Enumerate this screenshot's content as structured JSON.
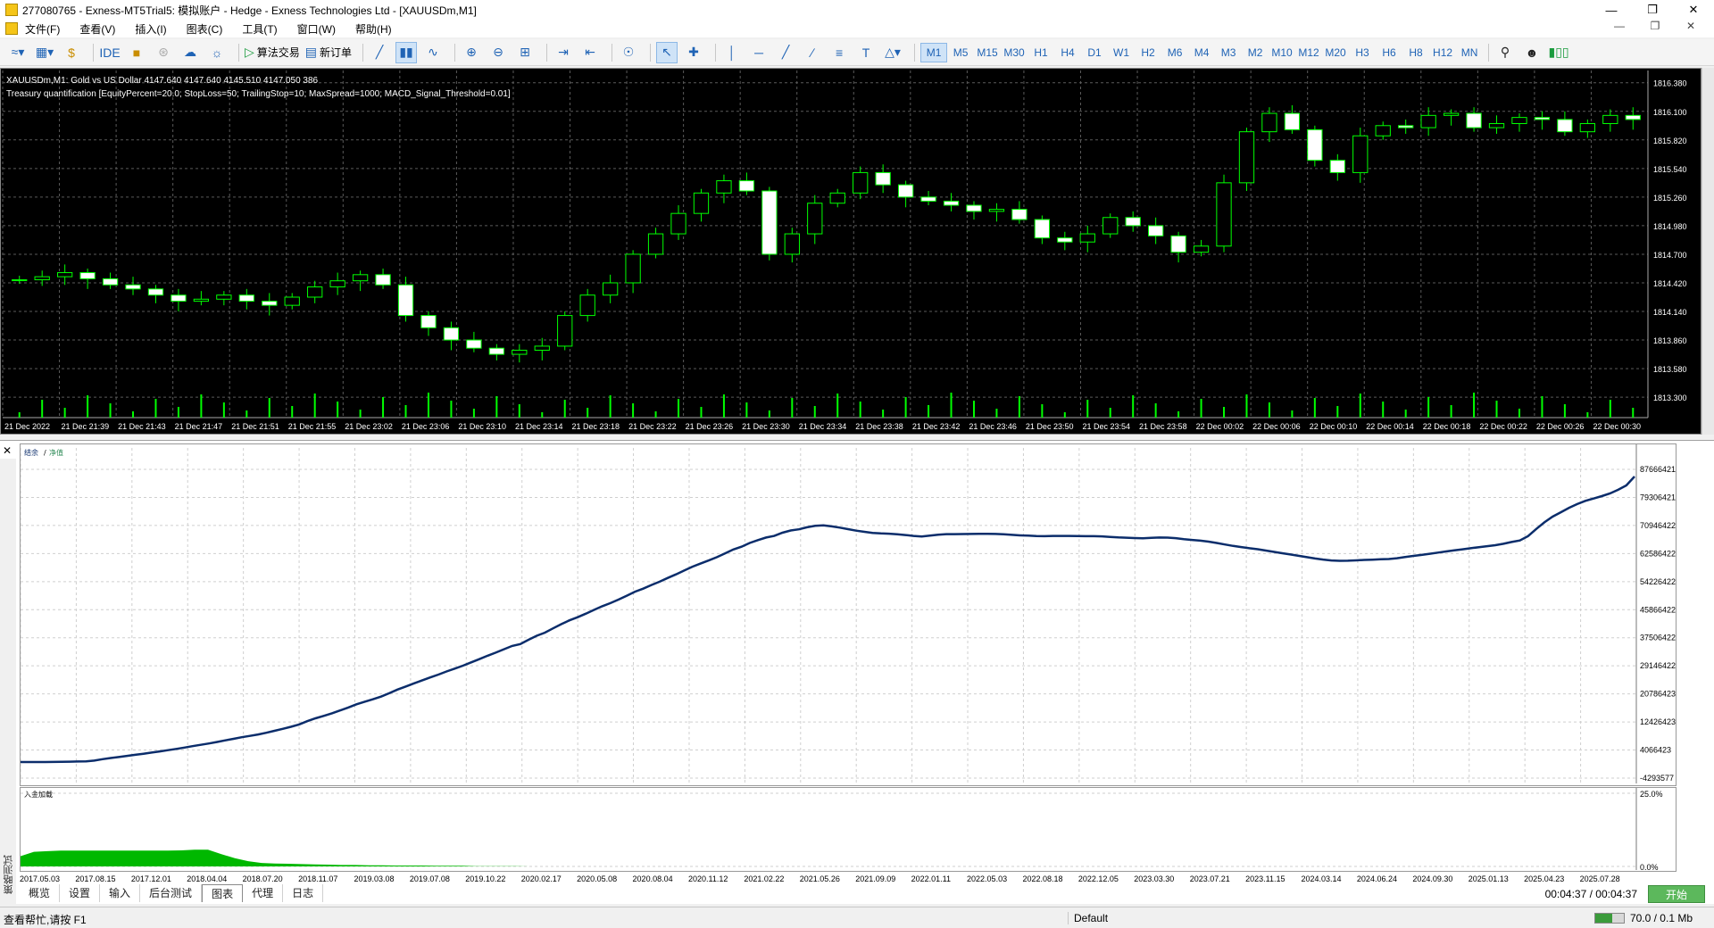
{
  "window": {
    "title": "277080765 - Exness-MT5Trial5: 模拟账户 - Hedge - Exness Technologies Ltd - [XAUUSDm,M1]"
  },
  "menu": {
    "items": [
      "文件(F)",
      "查看(V)",
      "插入(I)",
      "图表(C)",
      "工具(T)",
      "窗口(W)",
      "帮助(H)"
    ]
  },
  "toolbar": {
    "ide_label": "IDE",
    "algo_label": "算法交易",
    "neworder_label": "新订单",
    "timeframes": [
      "M1",
      "M5",
      "M15",
      "M30",
      "H1",
      "H4",
      "D1",
      "W1",
      "H2",
      "M6",
      "M4",
      "M3",
      "M2",
      "M10",
      "M12",
      "M20",
      "H3",
      "H6",
      "H8",
      "H12",
      "MN"
    ],
    "active_timeframe": "M1"
  },
  "chart": {
    "header_line1": "XAUUSDm,M1:  Gold vs US Dollar  4147.640 4147.640 4145.510 4147.050  386",
    "header_line2": "Treasury quantification [EquityPercent=20.0; StopLoss=50; TrailingStop=10; MaxSpread=1000; MACD_Signal_Threshold=0.01]",
    "colors": {
      "background": "#000000",
      "bull_candle": "#00ff00",
      "bear_candle_fill": "#ffffff",
      "grid": "#5a5a5a",
      "volume": "#00ff00",
      "axis_text": "#ffffff"
    }
  },
  "chart_data": [
    {
      "type": "candlestick",
      "title": "XAUUSDm,M1",
      "ylim": [
        1813.1,
        1816.5
      ],
      "y_ticks": [
        "1816.380",
        "1816.100",
        "1815.820",
        "1815.540",
        "1815.260",
        "1814.980",
        "1814.700",
        "1814.420",
        "1814.140",
        "1813.860",
        "1813.580",
        "1813.300"
      ],
      "x_ticks": [
        "21 Dec 2022",
        "21 Dec 21:39",
        "21 Dec 21:43",
        "21 Dec 21:47",
        "21 Dec 21:51",
        "21 Dec 21:55",
        "21 Dec 23:02",
        "21 Dec 23:06",
        "21 Dec 23:10",
        "21 Dec 23:14",
        "21 Dec 23:18",
        "21 Dec 23:22",
        "21 Dec 23:26",
        "21 Dec 23:30",
        "21 Dec 23:34",
        "21 Dec 23:38",
        "21 Dec 23:42",
        "21 Dec 23:46",
        "21 Dec 23:50",
        "21 Dec 23:54",
        "21 Dec 23:58",
        "22 Dec 00:02",
        "22 Dec 00:06",
        "22 Dec 00:10",
        "22 Dec 00:14",
        "22 Dec 00:18",
        "22 Dec 00:22",
        "22 Dec 00:26",
        "22 Dec 00:30"
      ],
      "close_path": [
        1814.45,
        1814.48,
        1814.52,
        1814.46,
        1814.4,
        1814.36,
        1814.3,
        1814.24,
        1814.26,
        1814.3,
        1814.24,
        1814.2,
        1814.28,
        1814.38,
        1814.44,
        1814.5,
        1814.4,
        1814.1,
        1813.98,
        1813.86,
        1813.78,
        1813.72,
        1813.76,
        1813.8,
        1814.1,
        1814.3,
        1814.42,
        1814.7,
        1814.9,
        1815.1,
        1815.3,
        1815.42,
        1815.32,
        1814.7,
        1814.9,
        1815.2,
        1815.3,
        1815.5,
        1815.38,
        1815.26,
        1815.22,
        1815.18,
        1815.12,
        1815.14,
        1815.04,
        1814.86,
        1814.82,
        1814.9,
        1815.06,
        1814.98,
        1814.88,
        1814.72,
        1814.78,
        1815.4,
        1815.9,
        1816.08,
        1815.92,
        1815.62,
        1815.5,
        1815.86,
        1815.96,
        1815.94,
        1816.06,
        1816.08,
        1815.94,
        1815.98,
        1816.04,
        1816.02,
        1815.9,
        1815.98,
        1816.06,
        1816.02
      ]
    },
    {
      "type": "line",
      "title": "",
      "legend": [
        "结余",
        "净值"
      ],
      "ylim": [
        -4793577,
        87666421
      ],
      "y_ticks": [
        "87666421",
        "79306421",
        "70946422",
        "62586422",
        "54226422",
        "45866422",
        "37506422",
        "29146422",
        "20786423",
        "12426423",
        "4066423",
        "-4293577"
      ],
      "x_ticks": [
        "2017.05.03",
        "2017.08.15",
        "2017.12.01",
        "2018.04.04",
        "2018.07.20",
        "2018.11.07",
        "2019.03.08",
        "2019.07.08",
        "2019.10.22",
        "2020.02.17",
        "2020.05.08",
        "2020.08.04",
        "2020.11.12",
        "2021.02.22",
        "2021.05.26",
        "2021.09.09",
        "2022.01.11",
        "2022.05.03",
        "2022.08.18",
        "2022.12.05",
        "2023.03.30",
        "2023.07.21",
        "2023.11.15",
        "2024.03.14",
        "2024.06.24",
        "2024.09.30",
        "2025.01.13",
        "2025.04.23",
        "2025.07.28"
      ],
      "series": [
        {
          "name": "结余",
          "color": "#0b2d6b",
          "values": [
            0,
            0,
            0,
            0,
            0.1,
            0.3,
            0.4,
            0.6,
            0.8,
            1.6,
            3.2,
            4.5,
            5.6,
            6.9,
            8.1,
            9.3,
            10.6,
            11.9,
            13.3,
            14.7,
            16.2,
            17.8,
            19.3,
            20.8,
            22.5,
            24.3,
            26.0,
            27.8,
            29.3,
            30.9,
            32.8,
            35.0,
            37.2,
            39.5,
            42.1,
            45.8,
            49.0,
            51.7,
            54.6,
            57.8,
            61.1,
            64.7,
            67.6,
            70.3,
            73.3,
            77.1,
            81.2,
            84.6,
            88.1,
            91.4,
            94.8,
            98.0,
            101.5,
            104.7,
            108.0,
            111.7,
            115.3,
            119.1,
            122.6,
            126.4,
            130.1,
            132.2,
            137.0,
            141.5,
            145.0,
            149.8,
            154.5,
            158.8,
            162.3,
            166.3,
            170.5,
            174.6,
            178.1,
            182.1,
            186.4,
            190.9,
            194.3,
            198.4,
            202.1,
            206.3,
            210.3,
            214.6,
            218.9,
            222.4,
            225.9,
            229.6,
            233.9,
            238.2,
            241.3,
            245.5,
            248.7,
            251.6,
            253.4,
            257.0,
            259.5,
            260.8,
            263.1,
            264.7,
            265.3,
            264.1,
            262.7,
            261.0,
            259.3,
            258.0,
            256.8,
            256.2,
            255.9,
            255.3,
            254.4,
            253.4,
            252.8,
            253.7,
            254.8,
            255.4,
            255.4,
            255.5,
            255.6,
            255.7,
            255.8,
            255.6,
            255.2,
            254.6,
            254.0,
            253.8,
            253.3,
            253.1,
            253.4,
            253.4,
            253.4,
            253.2,
            253.1,
            253.1,
            252.9,
            252.3,
            251.7,
            251.4,
            251.0,
            250.8,
            251.3,
            251.6,
            251.5,
            250.9,
            249.8,
            248.9,
            248.1,
            247.0,
            245.5,
            243.8,
            242.2,
            240.9,
            239.6,
            238.5,
            237.0,
            235.5,
            234.0,
            232.6,
            231.1,
            229.6,
            228.1,
            226.9,
            225.9,
            225.5,
            225.6,
            226.0,
            226.5,
            226.8,
            227.2,
            227.5,
            228.4,
            229.7,
            231.0,
            232.1,
            233.4,
            234.7,
            236.0,
            237.2,
            238.4,
            239.6,
            240.8,
            241.9,
            243.0,
            244.6,
            246.6,
            248.3,
            253.2,
            261.2,
            268.6,
            275.0,
            279.9,
            284.9,
            289.1,
            292.7,
            295.3,
            298.0,
            301.0,
            305.1,
            310.0,
            320.0
          ]
        },
        {
          "name": "净值",
          "color": "#2e8b57",
          "values": []
        }
      ]
    },
    {
      "type": "area",
      "title": "入金加载",
      "ylim": [
        0,
        25
      ],
      "y_ticks": [
        "25.0%",
        "0.0%"
      ],
      "series": [
        {
          "name": "入金加载",
          "color": "#00b800",
          "values": [
            3.5,
            5.0,
            5.2,
            5.4,
            5.4,
            5.4,
            5.4,
            5.4,
            5.4,
            5.4,
            5.4,
            5.4,
            5.5,
            5.7,
            5.7,
            4.2,
            2.8,
            1.8,
            1.2,
            1.0,
            0.9,
            0.8,
            0.7,
            0.6,
            0.5,
            0.5,
            0.4,
            0.4,
            0.3,
            0.3,
            0.3,
            0.2,
            0.2,
            0.2,
            0.1,
            0.1,
            0.1,
            0.1,
            0.0,
            0.0
          ]
        }
      ]
    }
  ],
  "tester": {
    "sidebar_label": "策略测试",
    "tabs": [
      "概览",
      "设置",
      "输入",
      "后台测试",
      "图表",
      "代理",
      "日志"
    ],
    "active_tab": "图表",
    "time_progress": "00:04:37 / 00:04:37",
    "start_label": "开始"
  },
  "status": {
    "help_text": "查看帮忙,请按 F1",
    "profile": "Default",
    "net_text": "70.0 / 0.1 Mb"
  }
}
